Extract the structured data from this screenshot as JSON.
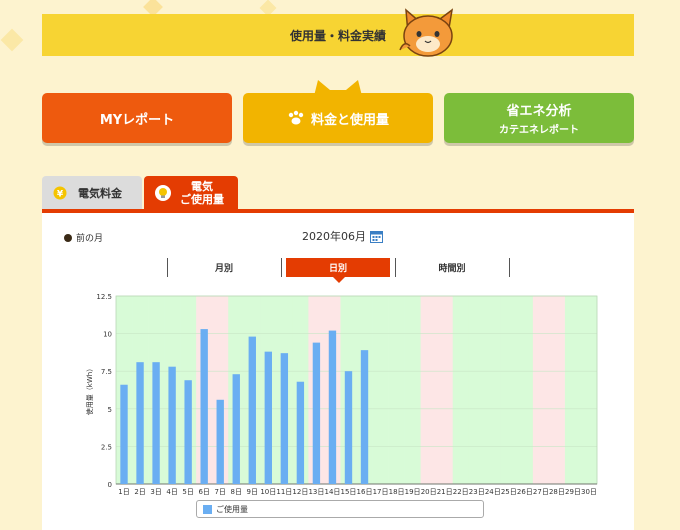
{
  "header": {
    "title": "使用量・料金実績"
  },
  "nav": {
    "report": "MYレポート",
    "fee_usage": "料金と使用量",
    "eco_title": "省エネ分析",
    "eco_sub": "カテエネレポート"
  },
  "tabs": {
    "fee": "電気料金",
    "usage_line1": "電気",
    "usage_line2": "ご使用量"
  },
  "controls": {
    "prev_month": "前の月",
    "month": "2020年06月",
    "period_tabs": [
      "月別",
      "日別",
      "時間別"
    ],
    "selected_period": "日別"
  },
  "colors": {
    "accent": "#e43c02",
    "bar": "#6aaef2",
    "weekday_bg": "#d8fbd7",
    "weekend_bg": "#fde6e6"
  },
  "chart_data": {
    "type": "bar",
    "ylabel": "使用量（kWh）",
    "ylim": [
      0,
      12.5
    ],
    "yticks": [
      "0",
      "2.5",
      "5",
      "7.5",
      "10",
      "12.5"
    ],
    "categories": [
      "1日",
      "2日",
      "3日",
      "4日",
      "5日",
      "6日",
      "7日",
      "8日",
      "9日",
      "10日",
      "11日",
      "12日",
      "13日",
      "14日",
      "15日",
      "16日",
      "17日",
      "18日",
      "19日",
      "20日",
      "21日",
      "22日",
      "23日",
      "24日",
      "25日",
      "26日",
      "27日",
      "28日",
      "29日",
      "30日"
    ],
    "weekend_days": [
      6,
      7,
      13,
      14,
      20,
      21,
      27,
      28
    ],
    "series": [
      {
        "name": "ご使用量",
        "values": [
          6.6,
          8.1,
          8.1,
          7.8,
          6.9,
          10.3,
          5.6,
          7.3,
          9.8,
          8.8,
          8.7,
          6.8,
          9.4,
          10.2,
          7.5,
          8.9,
          null,
          null,
          null,
          null,
          null,
          null,
          null,
          null,
          null,
          null,
          null,
          null,
          null,
          null
        ]
      }
    ]
  }
}
